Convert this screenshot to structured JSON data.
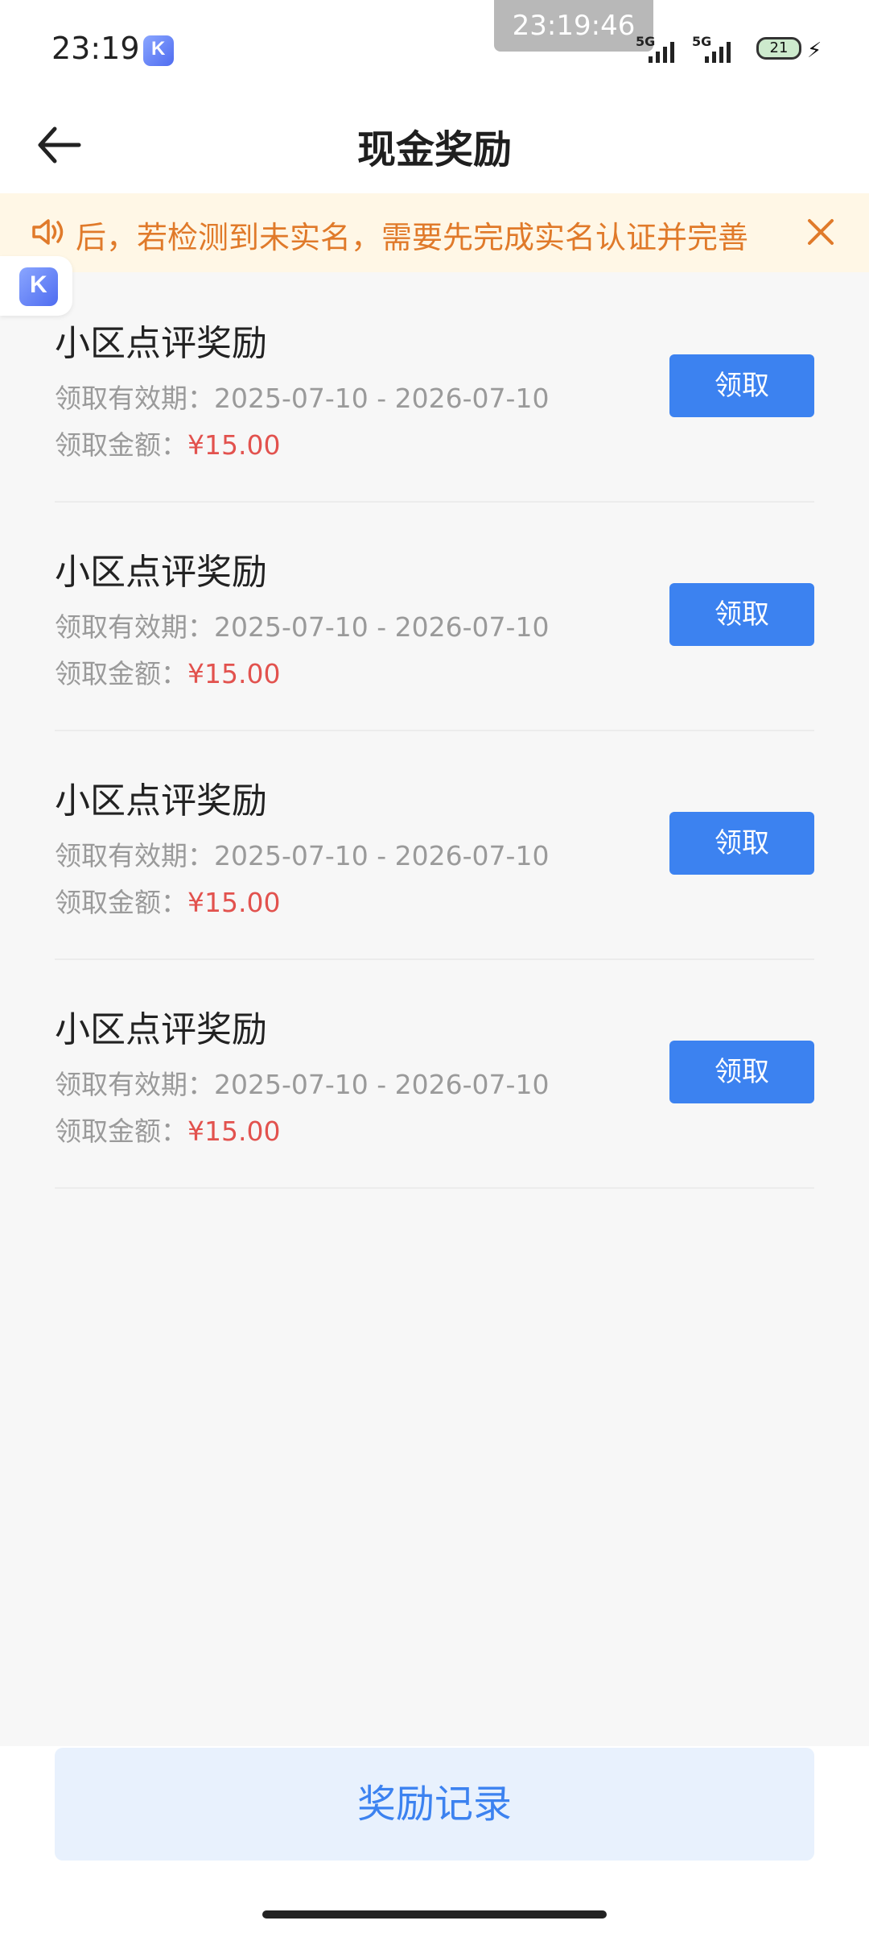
{
  "status_bar": {
    "time": "23:19",
    "clock_overlay": "23:19:46",
    "network1": "5G",
    "network2": "5G",
    "battery": "21"
  },
  "header": {
    "title": "现金奖励",
    "back_icon": "arrow-left"
  },
  "notice": {
    "text": "后，若检测到未实名，需要先完成实名认证并完善",
    "icon": "speaker",
    "close_icon": "close"
  },
  "rewards": [
    {
      "title": "小区点评奖励",
      "period_label": "领取有效期：",
      "period": "2025-07-10 - 2026-07-10",
      "amount_label": "领取金额：",
      "amount": "¥15.00",
      "button": "领取"
    },
    {
      "title": "小区点评奖励",
      "period_label": "领取有效期：",
      "period": "2025-07-10 - 2026-07-10",
      "amount_label": "领取金额：",
      "amount": "¥15.00",
      "button": "领取"
    },
    {
      "title": "小区点评奖励",
      "period_label": "领取有效期：",
      "period": "2025-07-10 - 2026-07-10",
      "amount_label": "领取金额：",
      "amount": "¥15.00",
      "button": "领取"
    },
    {
      "title": "小区点评奖励",
      "period_label": "领取有效期：",
      "period": "2025-07-10 - 2026-07-10",
      "amount_label": "领取金额：",
      "amount": "¥15.00",
      "button": "领取"
    }
  ],
  "footer": {
    "records_button": "奖励记录"
  },
  "colors": {
    "accent": "#3c82f0",
    "amount": "#e2524e",
    "notice_text": "#e07a2a",
    "notice_bg": "#fff7e6"
  }
}
